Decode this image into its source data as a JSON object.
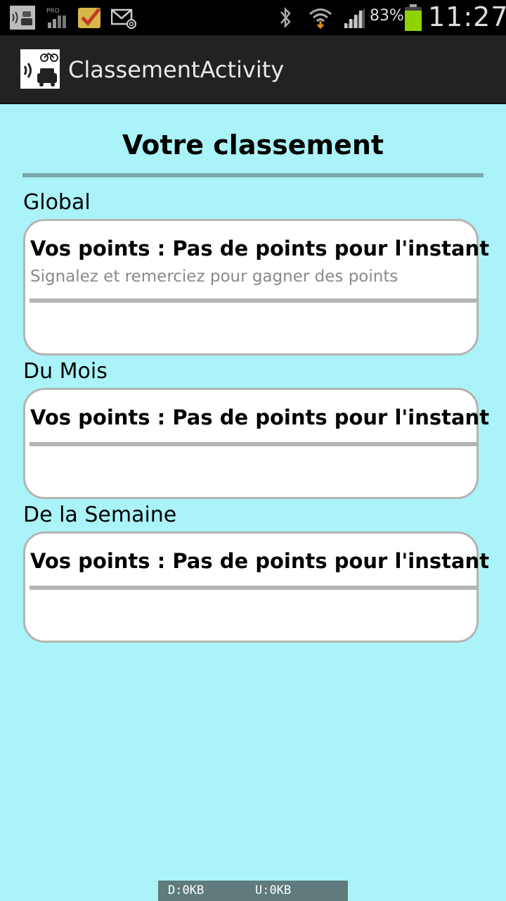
{
  "status_bar": {
    "icons": [
      "app-notification-icon",
      "pro-signal-icon",
      "task-check-icon",
      "email-at-icon",
      "bluetooth-icon",
      "wifi-icon",
      "cell-signal-icon",
      "battery-icon"
    ],
    "battery_percent": "83%",
    "time": "11:27",
    "battery_color": "#8fd400"
  },
  "action_bar": {
    "title": "ClassementActivity"
  },
  "main": {
    "title": "Votre classement",
    "sections": [
      {
        "label": "Global",
        "points_text": "Vos points : Pas de points pour l'instant",
        "hint": "Signalez et remerciez pour gagner des points"
      },
      {
        "label": "Du Mois",
        "points_text": "Vos points : Pas de points pour l'instant"
      },
      {
        "label": "De la Semaine",
        "points_text": "Vos points : Pas de points pour l'instant"
      }
    ]
  },
  "traffic": {
    "download": "D:0KB",
    "upload": "U:0KB"
  },
  "colors": {
    "background": "#aaf3f8",
    "rule": "#7aa9aa",
    "card_border": "#b4b4b4"
  }
}
